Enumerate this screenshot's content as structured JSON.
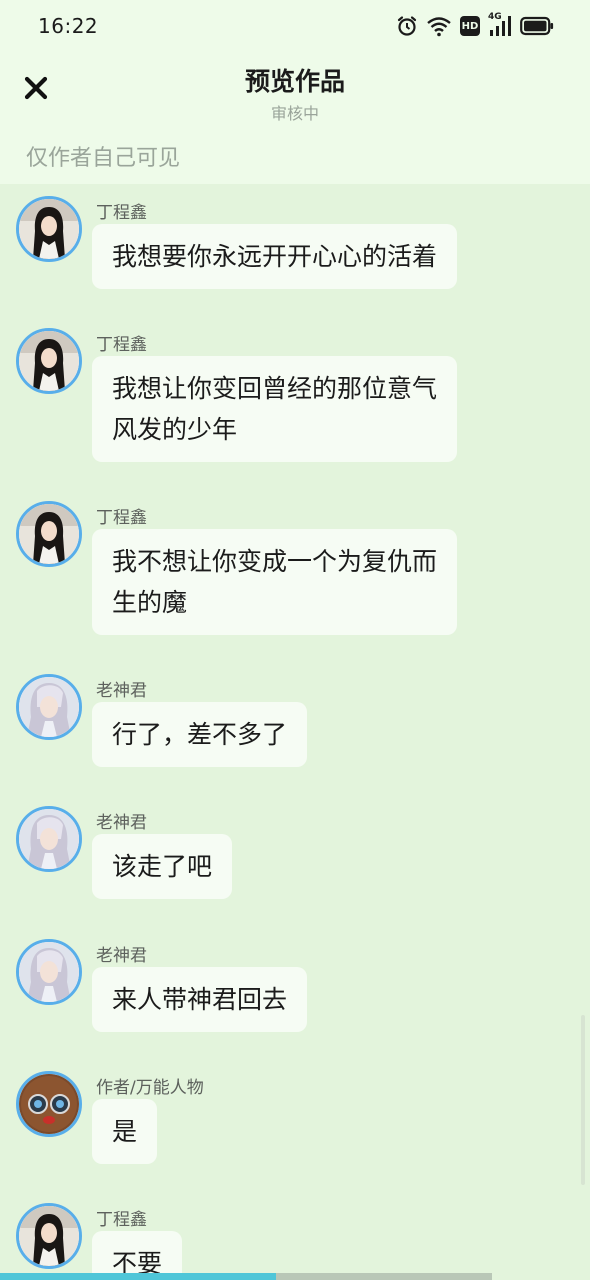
{
  "status_bar": {
    "time": "16:22",
    "network_label": "4G",
    "hd_label": "HD",
    "icons": [
      "alarm-icon",
      "wifi-icon",
      "hd-icon",
      "signal-icon",
      "battery-icon"
    ]
  },
  "header": {
    "title": "预览作品",
    "subtitle": "审核中",
    "close_icon": "close-icon"
  },
  "visibility_note": "仅作者自己可见",
  "messages": [
    {
      "sender": "丁程鑫",
      "avatar": "avatar-ding",
      "lines": [
        "我想要你永远开开心心的活着"
      ]
    },
    {
      "sender": "丁程鑫",
      "avatar": "avatar-ding",
      "lines": [
        "我想让你变回曾经的那位意气",
        "风发的少年"
      ]
    },
    {
      "sender": "丁程鑫",
      "avatar": "avatar-ding",
      "lines": [
        "我不想让你变成一个为复仇而",
        "生的魔"
      ]
    },
    {
      "sender": "老神君",
      "avatar": "avatar-elder",
      "lines": [
        "行了，差不多了"
      ]
    },
    {
      "sender": "老神君",
      "avatar": "avatar-elder",
      "lines": [
        "该走了吧"
      ]
    },
    {
      "sender": "老神君",
      "avatar": "avatar-elder",
      "lines": [
        "来人带神君回去"
      ]
    },
    {
      "sender": "作者/万能人物",
      "avatar": "avatar-author",
      "lines": [
        "是"
      ]
    },
    {
      "sender": "丁程鑫",
      "avatar": "avatar-ding",
      "lines": [
        "不要"
      ]
    }
  ],
  "colors": {
    "background": "#e3f4dc",
    "header_background": "#eefbe9",
    "bubble": "#f6fcf4",
    "avatar_border": "#58aeea",
    "progress_done": "#4fc6d8",
    "progress_rest": "#b9c7b7"
  }
}
